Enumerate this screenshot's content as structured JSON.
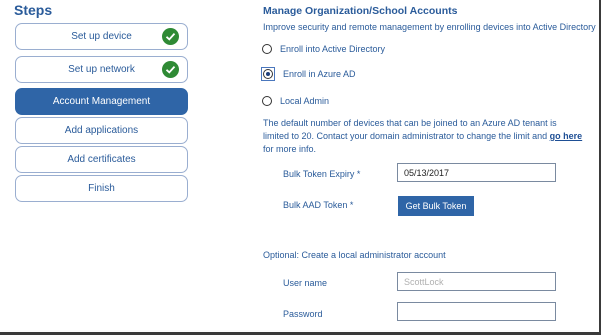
{
  "steps": {
    "title": "Steps",
    "items": [
      {
        "label": "Set up device",
        "state": "complete"
      },
      {
        "label": "Set up network",
        "state": "complete"
      },
      {
        "label": "Account Management",
        "state": "active"
      },
      {
        "label": "Add applications",
        "state": "pending"
      },
      {
        "label": "Add certificates",
        "state": "pending"
      },
      {
        "label": "Finish",
        "state": "pending"
      }
    ]
  },
  "account": {
    "title": "Manage Organization/School Accounts",
    "subtitle": "Improve security and remote management by enrolling devices into Active Directory",
    "options": [
      {
        "label": "Enroll into Active Directory",
        "selected": false
      },
      {
        "label": "Enroll in Azure AD",
        "selected": true
      },
      {
        "label": "Local Admin",
        "selected": false
      }
    ],
    "info_text": "The default number of devices that can be joined to an Azure AD tenant is limited to 20. Contact your domain administrator to change the limit and ",
    "info_link": "go here",
    "info_suffix": " for more info.",
    "bulk_token_expiry_label": "Bulk Token Expiry",
    "bulk_token_expiry_value": "05/13/2017",
    "bulk_aad_token_label": "Bulk AAD Token",
    "required_marker": "*",
    "get_bulk_token_button": "Get Bulk Token",
    "optional_heading": "Optional: Create a local administrator account",
    "username_label": "User name",
    "username_placeholder": "ScottLock",
    "password_label": "Password",
    "password_value": ""
  },
  "colors": {
    "accent": "#2f65a7",
    "text_blue": "#2a5b9a",
    "check_green": "#2f8a35"
  }
}
